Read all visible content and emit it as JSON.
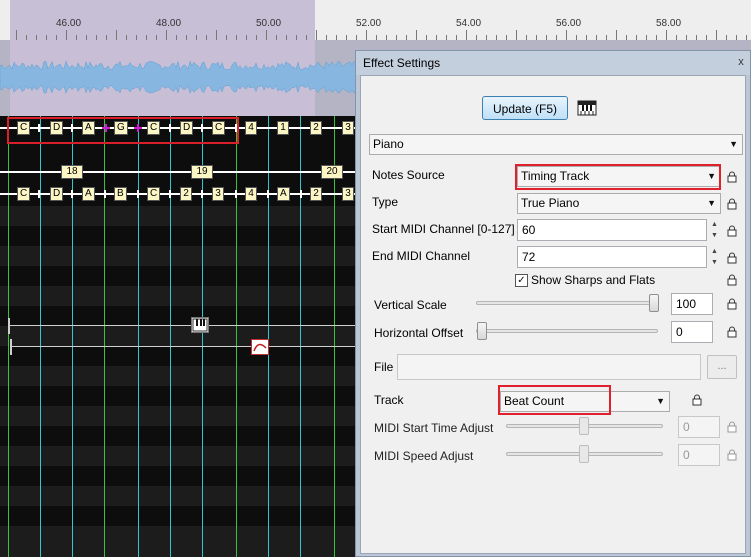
{
  "ruler": {
    "ticks": [
      "46.00",
      "48.00",
      "50.00",
      "52.00",
      "54.00",
      "56.00",
      "58.00"
    ]
  },
  "timing_marks": {
    "row1": [
      "C",
      "D",
      "A",
      "G",
      "C",
      "D",
      "C",
      "4",
      "1",
      "2",
      "3"
    ],
    "row2_numbers": [
      "18",
      "19",
      "20"
    ],
    "row3": [
      "C",
      "D",
      "A",
      "B",
      "C",
      "2",
      "3",
      "4",
      "A",
      "2",
      "3"
    ]
  },
  "dialog": {
    "title": "Effect Settings",
    "close_glyph": "x",
    "update_button": "Update (F5)",
    "effect_selected": "Piano",
    "fields": {
      "notes_source": {
        "label": "Notes Source",
        "value": "Timing Track"
      },
      "type": {
        "label": "Type",
        "value": "True Piano"
      },
      "start_midi": {
        "label": "Start MIDI Channel [0-127]",
        "value": "60"
      },
      "end_midi": {
        "label": "End MIDI Channel",
        "value": "72"
      },
      "show_sharps": {
        "label": "Show Sharps and Flats",
        "checked": true
      },
      "vertical_scale": {
        "label": "Vertical Scale",
        "value": "100",
        "level": 1.0
      },
      "horizontal_offset": {
        "label": "Horizontal Offset",
        "value": "0",
        "level": 0.0
      },
      "file": {
        "label": "File",
        "value": "",
        "button": "..."
      },
      "track": {
        "label": "Track",
        "value": "Beat Count"
      },
      "midi_start_time": {
        "label": "MIDI Start Time Adjust",
        "value": "0",
        "level": 0.5
      },
      "midi_speed": {
        "label": "MIDI Speed Adjust",
        "value": "0",
        "level": 0.5
      }
    }
  },
  "colors": {
    "highlight": "#e0202c",
    "timing_cyan": "#31c7d0",
    "timing_green": "#37c43a",
    "tag_fill": "#fbf6c4"
  }
}
